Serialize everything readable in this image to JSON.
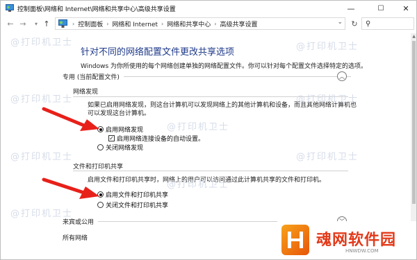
{
  "window": {
    "title": "控制面板\\网络和 Internet\\网络和共享中心\\高级共享设置",
    "minimize_icon": "minimize-icon",
    "maximize_icon": "maximize-icon",
    "close_icon": "close-icon"
  },
  "address": {
    "crumbs": [
      "控制面板",
      "网络和 Internet",
      "网络和共享中心",
      "高级共享设置"
    ]
  },
  "main": {
    "heading": "针对不同的网络配置文件更改共享选项",
    "description": "Windows 为你所使用的每个网络创建单独的网络配置文件。你可以针对每个配置文件选择特定的选项。",
    "private_section": {
      "label": "专用 (当前配置文件)",
      "discovery": {
        "title": "网络发现",
        "text_line1": "如果已启用网络发现，则这台计算机可以发现网络上的其他计算机和设备，而且其他网络计算机也",
        "text_line2": "可以发现这台计算机。",
        "opt_enable": "启用网络发现",
        "opt_auto": "启用网络连接设备的自动设置。",
        "opt_disable": "关闭网络发现"
      },
      "sharing": {
        "title": "文件和打印机共享",
        "text": "启用文件和打印机共享时，网络上的用户可以访问通过此计算机共享的文件和打印机。",
        "opt_enable": "启用文件和打印机共享",
        "opt_disable": "关闭文件和打印机共享"
      }
    },
    "guest_section": {
      "label": "来宾或公用"
    },
    "all_section": {
      "label": "所有网络"
    }
  },
  "watermark": "@打印机卫士",
  "brand": {
    "name": "魂网软件园",
    "url": "HNWDW.COM",
    "color": "#e23a1a"
  },
  "colors": {
    "heading": "#1f3a8a",
    "arrow": "#e8201a"
  }
}
